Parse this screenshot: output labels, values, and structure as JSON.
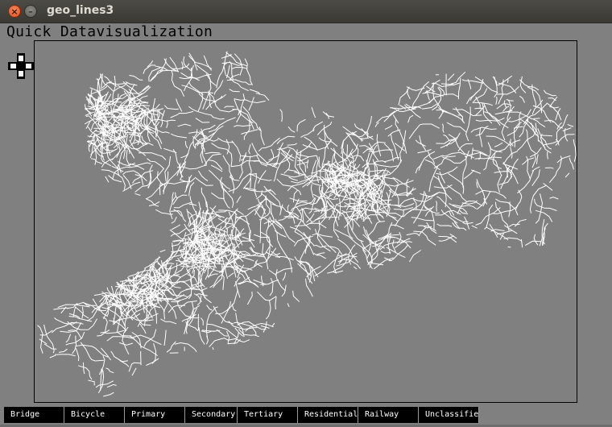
{
  "window": {
    "title": "geo_lines3",
    "close_icon": "close-icon",
    "minimize_icon": "minimize-icon"
  },
  "app": {
    "heading": "Quick Datavisualization"
  },
  "map": {
    "background_color": "#808080",
    "line_color": "#ffffff",
    "pan_control_icon": "pan-cross-icon"
  },
  "legend": {
    "items": [
      {
        "label": "Bridge"
      },
      {
        "label": "Bicycle"
      },
      {
        "label": "Primary"
      },
      {
        "label": "Secondary"
      },
      {
        "label": "Tertiary"
      },
      {
        "label": "Residential"
      },
      {
        "label": "Railway"
      },
      {
        "label": "Unclassified"
      }
    ]
  }
}
